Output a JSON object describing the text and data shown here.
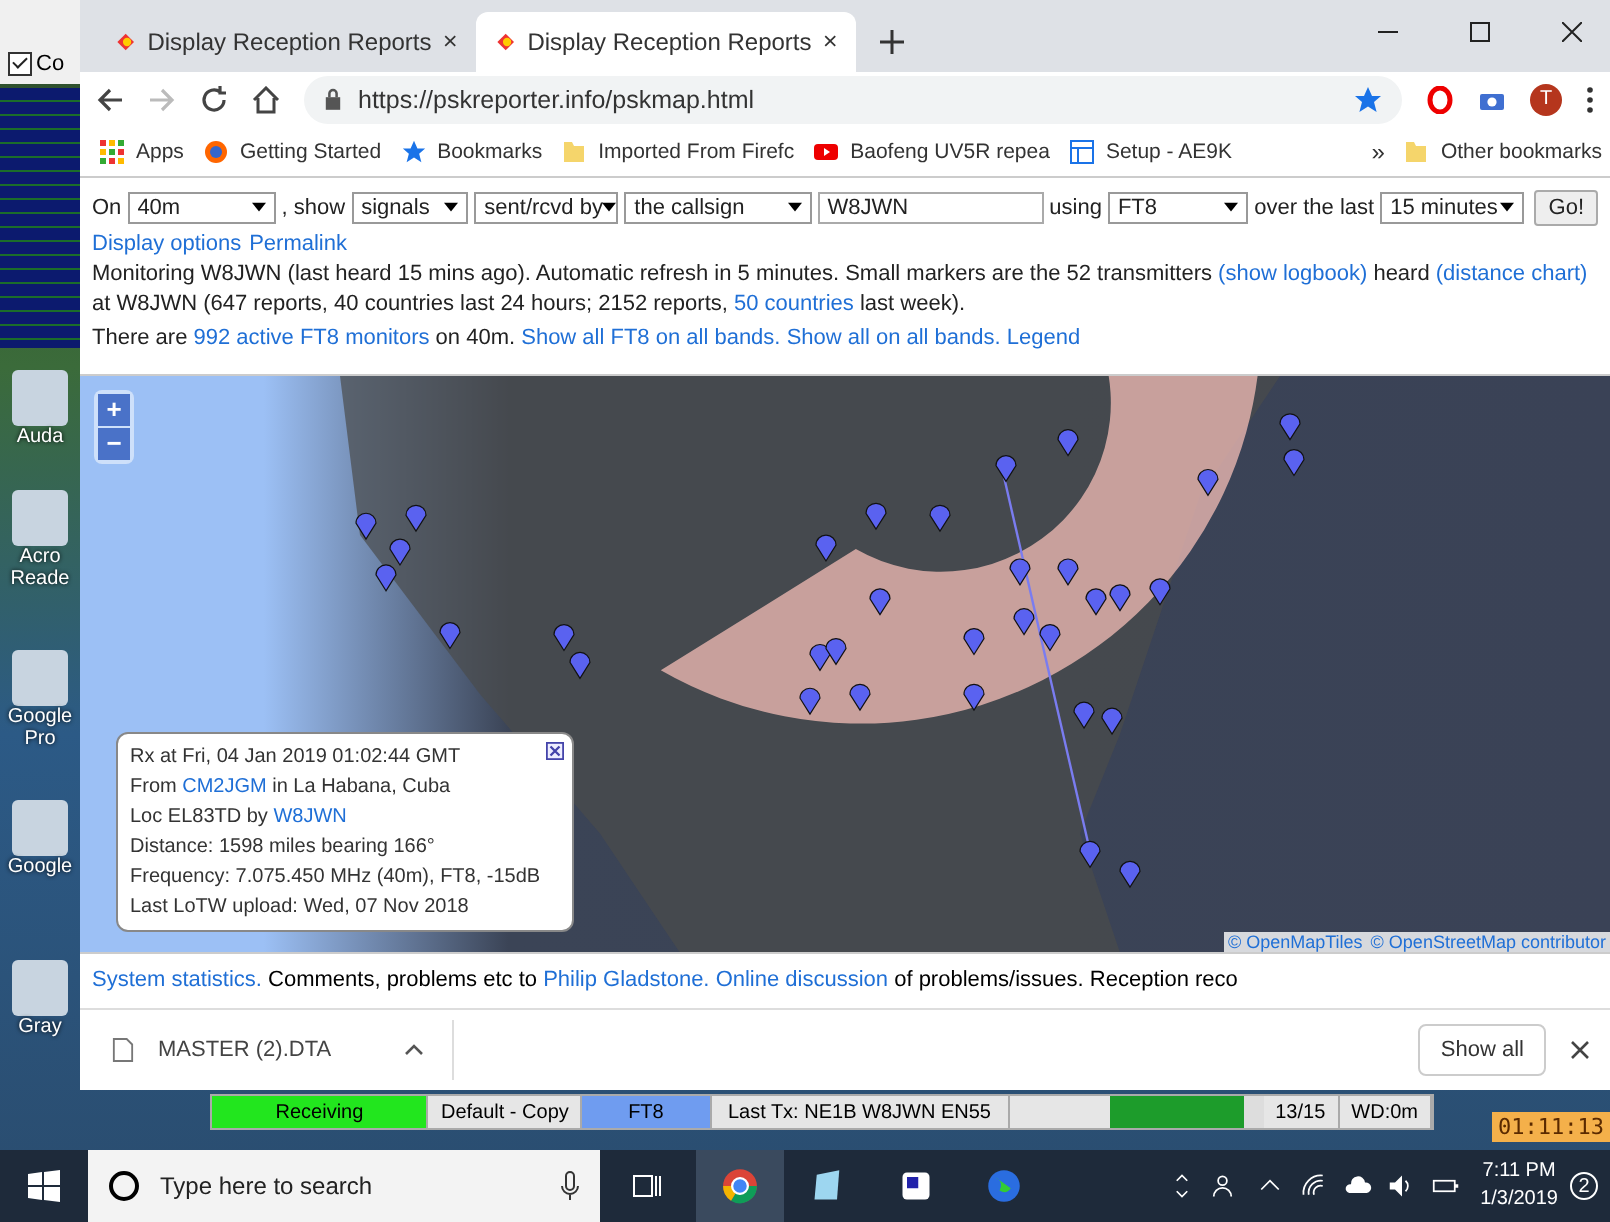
{
  "desktop": {
    "window_fragment": {
      "checkbox_label": "Co",
      "checked": true
    },
    "icons": [
      {
        "label": "Auda"
      },
      {
        "label": "Acro Reade"
      },
      {
        "label": "Google Pro"
      },
      {
        "label": "Google"
      },
      {
        "label": "Gray"
      }
    ]
  },
  "browser": {
    "tabs": [
      {
        "title": "Display Reception Reports",
        "selected": false
      },
      {
        "title": "Display Reception Reports",
        "selected": true
      }
    ],
    "url": "https://pskreporter.info/pskmap.html",
    "avatar": "T",
    "bookmarks": [
      {
        "kind": "apps",
        "label": "Apps"
      },
      {
        "kind": "firefox",
        "label": "Getting Started"
      },
      {
        "kind": "star",
        "label": "Bookmarks"
      },
      {
        "kind": "folder",
        "label": "Imported From Firefc"
      },
      {
        "kind": "youtube",
        "label": "Baofeng UV5R repea"
      },
      {
        "kind": "doc",
        "label": "Setup - AE9K"
      }
    ],
    "overflow": "»",
    "other_bookmarks": "Other bookmarks",
    "download": {
      "file": "MASTER (2).DTA",
      "show_all": "Show all"
    }
  },
  "page": {
    "form": [
      {
        "kind": "label",
        "text": "On"
      },
      {
        "kind": "select",
        "text": "40m"
      },
      {
        "kind": "label",
        "text": ", show"
      },
      {
        "kind": "select",
        "text": "signals"
      },
      {
        "kind": "select",
        "text": "sent/rcvd by"
      },
      {
        "kind": "select",
        "text": "the callsign"
      },
      {
        "kind": "input",
        "text": "W8JWN"
      },
      {
        "kind": "label",
        "text": "using"
      },
      {
        "kind": "select",
        "text": "FT8"
      },
      {
        "kind": "label",
        "text": "over the last"
      },
      {
        "kind": "select",
        "text": "15 minutes"
      },
      {
        "kind": "button",
        "text": "Go!"
      }
    ],
    "links": [
      "Display options",
      "Permalink"
    ],
    "paragraphs": [
      [
        {
          "text": "Monitoring W8JWN (last heard 15 mins ago). Automatic refresh in 5 minutes. Small markers are the 52 transmitters ",
          "link": false
        },
        {
          "text": "(show logbook)",
          "link": true
        },
        {
          "text": " heard ",
          "link": false
        },
        {
          "text": "(distance chart)",
          "link": true
        },
        {
          "text": " at W8JWN (647 reports, 40 countries last 24 hours; 2152 reports, ",
          "link": false
        },
        {
          "text": "50 countries",
          "link": true
        },
        {
          "text": " last week).",
          "link": false
        }
      ],
      [
        {
          "text": "There are ",
          "link": false
        },
        {
          "text": "992 active FT8 monitors",
          "link": true
        },
        {
          "text": " on 40m. ",
          "link": false
        },
        {
          "text": "Show all FT8 on all bands.",
          "link": true
        },
        {
          "text": "Show all on all bands.",
          "link": true
        },
        {
          "text": "Legend",
          "link": true
        }
      ]
    ],
    "map": {
      "zoom": [
        "+",
        "−"
      ],
      "attribution": [
        "© OpenMapTiles",
        "© OpenStreetMap contributor"
      ],
      "popup": [
        [
          {
            "text": "Rx at Fri, 04 Jan 2019 01:02:44 GMT",
            "link": false
          }
        ],
        [
          {
            "text": "From ",
            "link": false
          },
          {
            "text": "CM2JGM",
            "link": true
          },
          {
            "text": " in La Habana, Cuba",
            "link": false
          }
        ],
        [
          {
            "text": "Loc EL83TD by ",
            "link": false
          },
          {
            "text": "W8JWN",
            "link": true
          }
        ],
        [
          {
            "text": "Distance: 1598 miles bearing 166°",
            "link": false
          }
        ],
        [
          {
            "text": "Frequency: 7.075.450 MHz (40m), FT8, -15dB",
            "link": false
          }
        ],
        [
          {
            "text": "Last LoTW upload: Wed, 07 Nov 2018",
            "link": false
          }
        ]
      ]
    },
    "footer": [
      {
        "text": "System statistics.",
        "link": true
      },
      {
        "text": " Comments, problems etc to ",
        "link": false
      },
      {
        "text": "Philip Gladstone.",
        "link": true
      },
      {
        "text": "Online discussion",
        "link": true
      },
      {
        "text": " of problems/issues. Reception reco",
        "link": false
      }
    ]
  },
  "wsjt_bar": {
    "cells": [
      {
        "kind": "status",
        "text": "Receiving",
        "color": "#22e61e"
      },
      {
        "kind": "text",
        "text": "Default - Copy"
      },
      {
        "kind": "status",
        "text": "FT8",
        "color": "#6f9cf0"
      },
      {
        "kind": "text",
        "text": "Last Tx: NE1B W8JWN EN55"
      },
      {
        "kind": "meter",
        "level": 0.87
      },
      {
        "kind": "text",
        "text": "13/15"
      },
      {
        "kind": "text",
        "text": "WD:0m"
      }
    ],
    "clock": "01:11:13"
  },
  "taskbar": {
    "search": "Type here to search",
    "time": "7:11 PM",
    "date": "1/3/2019",
    "notifications": "2"
  }
}
